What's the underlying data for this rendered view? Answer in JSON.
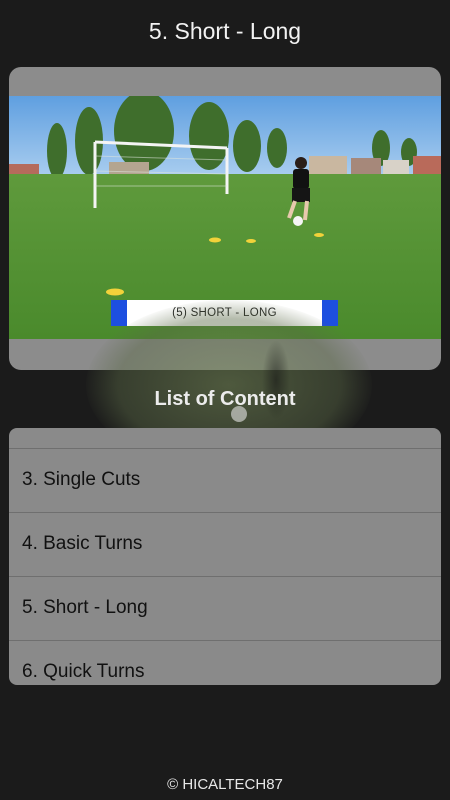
{
  "header": {
    "title": "5. Short - Long"
  },
  "video": {
    "caption": "(5) SHORT - LONG"
  },
  "section": {
    "heading": "List of Content"
  },
  "list": {
    "items": [
      {
        "label": ""
      },
      {
        "label": "3. Single Cuts"
      },
      {
        "label": "4. Basic Turns"
      },
      {
        "label": "5. Short - Long"
      },
      {
        "label": "6. Quick Turns"
      }
    ]
  },
  "footer": {
    "text": "© HICALTECH87"
  },
  "colors": {
    "background": "#1b1b1b",
    "card": "#8a8a8a",
    "caption_accent": "#1d4fe0"
  }
}
